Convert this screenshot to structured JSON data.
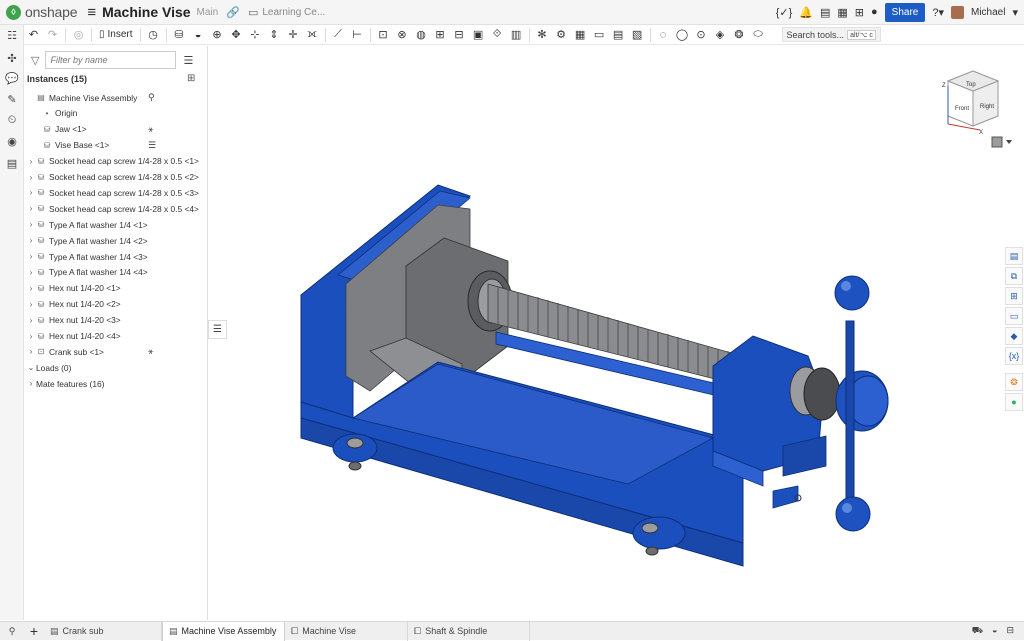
{
  "app": {
    "logo_text": "onshape",
    "doc_title": "Machine Vise",
    "branch": "Main",
    "breadcrumb": "Learning Ce..."
  },
  "topbar": {
    "share_label": "Share",
    "user_name": "Michael",
    "icons": [
      "code-icon",
      "bell-icon",
      "notes-icon",
      "calculator-icon",
      "apps-icon",
      "globe-icon",
      "help-icon"
    ]
  },
  "toolbar": {
    "insert_label": "Insert",
    "search_label": "Search tools...",
    "search_shortcut": "alt/⌥ c"
  },
  "panel": {
    "filter_placeholder": "Filter by name",
    "instances_header": "Instances (15)",
    "tree": [
      {
        "label": "Machine Vise Assembly",
        "indent": 0,
        "expandable": false,
        "icon": "assembly-icon",
        "badge": "tree-icon"
      },
      {
        "label": "Origin",
        "indent": 1,
        "expandable": false,
        "icon": "origin-icon"
      },
      {
        "label": "Jaw <1>",
        "indent": 1,
        "expandable": false,
        "icon": "part-icon",
        "badge": "fixed-icon"
      },
      {
        "label": "Vise Base <1>",
        "indent": 1,
        "expandable": false,
        "icon": "part-icon",
        "badge": "group-icon"
      },
      {
        "label": "Socket head cap screw 1/4-28 x 0.5 <1>",
        "indent": 1,
        "expandable": true,
        "icon": "part-icon"
      },
      {
        "label": "Socket head cap screw 1/4-28 x 0.5 <2>",
        "indent": 1,
        "expandable": true,
        "icon": "part-icon"
      },
      {
        "label": "Socket head cap screw 1/4-28 x 0.5 <3>",
        "indent": 1,
        "expandable": true,
        "icon": "part-icon"
      },
      {
        "label": "Socket head cap screw 1/4-28 x 0.5 <4>",
        "indent": 1,
        "expandable": true,
        "icon": "part-icon"
      },
      {
        "label": "Type A flat washer 1/4 <1>",
        "indent": 1,
        "expandable": true,
        "icon": "part-icon"
      },
      {
        "label": "Type A flat washer 1/4 <2>",
        "indent": 1,
        "expandable": true,
        "icon": "part-icon"
      },
      {
        "label": "Type A flat washer 1/4 <3>",
        "indent": 1,
        "expandable": true,
        "icon": "part-icon"
      },
      {
        "label": "Type A flat washer 1/4 <4>",
        "indent": 1,
        "expandable": true,
        "icon": "part-icon"
      },
      {
        "label": "Hex nut 1/4-20 <1>",
        "indent": 1,
        "expandable": true,
        "icon": "part-icon"
      },
      {
        "label": "Hex nut 1/4-20 <2>",
        "indent": 1,
        "expandable": true,
        "icon": "part-icon"
      },
      {
        "label": "Hex nut 1/4-20 <3>",
        "indent": 1,
        "expandable": true,
        "icon": "part-icon"
      },
      {
        "label": "Hex nut 1/4-20 <4>",
        "indent": 1,
        "expandable": true,
        "icon": "part-icon"
      },
      {
        "label": "Crank sub <1>",
        "indent": 1,
        "expandable": true,
        "icon": "subassembly-icon",
        "badge": "fixed-icon"
      },
      {
        "label": "Loads (0)",
        "indent": 0,
        "expandable": true,
        "open": true,
        "icon": ""
      },
      {
        "label": "Mate features (16)",
        "indent": 0,
        "expandable": true,
        "icon": ""
      }
    ]
  },
  "viewcube": {
    "front": "Front",
    "top": "Top",
    "right": "Right",
    "axis_x": "X",
    "axis_z": "Z"
  },
  "tabs": [
    {
      "label": "Crank sub",
      "icon": "assembly-icon",
      "active": false
    },
    {
      "label": "Machine Vise Assembly",
      "icon": "assembly-icon",
      "active": true
    },
    {
      "label": "Machine Vise",
      "icon": "partstudio-icon",
      "active": false
    },
    {
      "label": "Shaft & Spindle",
      "icon": "partstudio-icon",
      "active": false
    }
  ],
  "colors": {
    "accent": "#1e5ec4",
    "part_blue": "#1b4fbd",
    "part_grey": "#7d7f82"
  }
}
